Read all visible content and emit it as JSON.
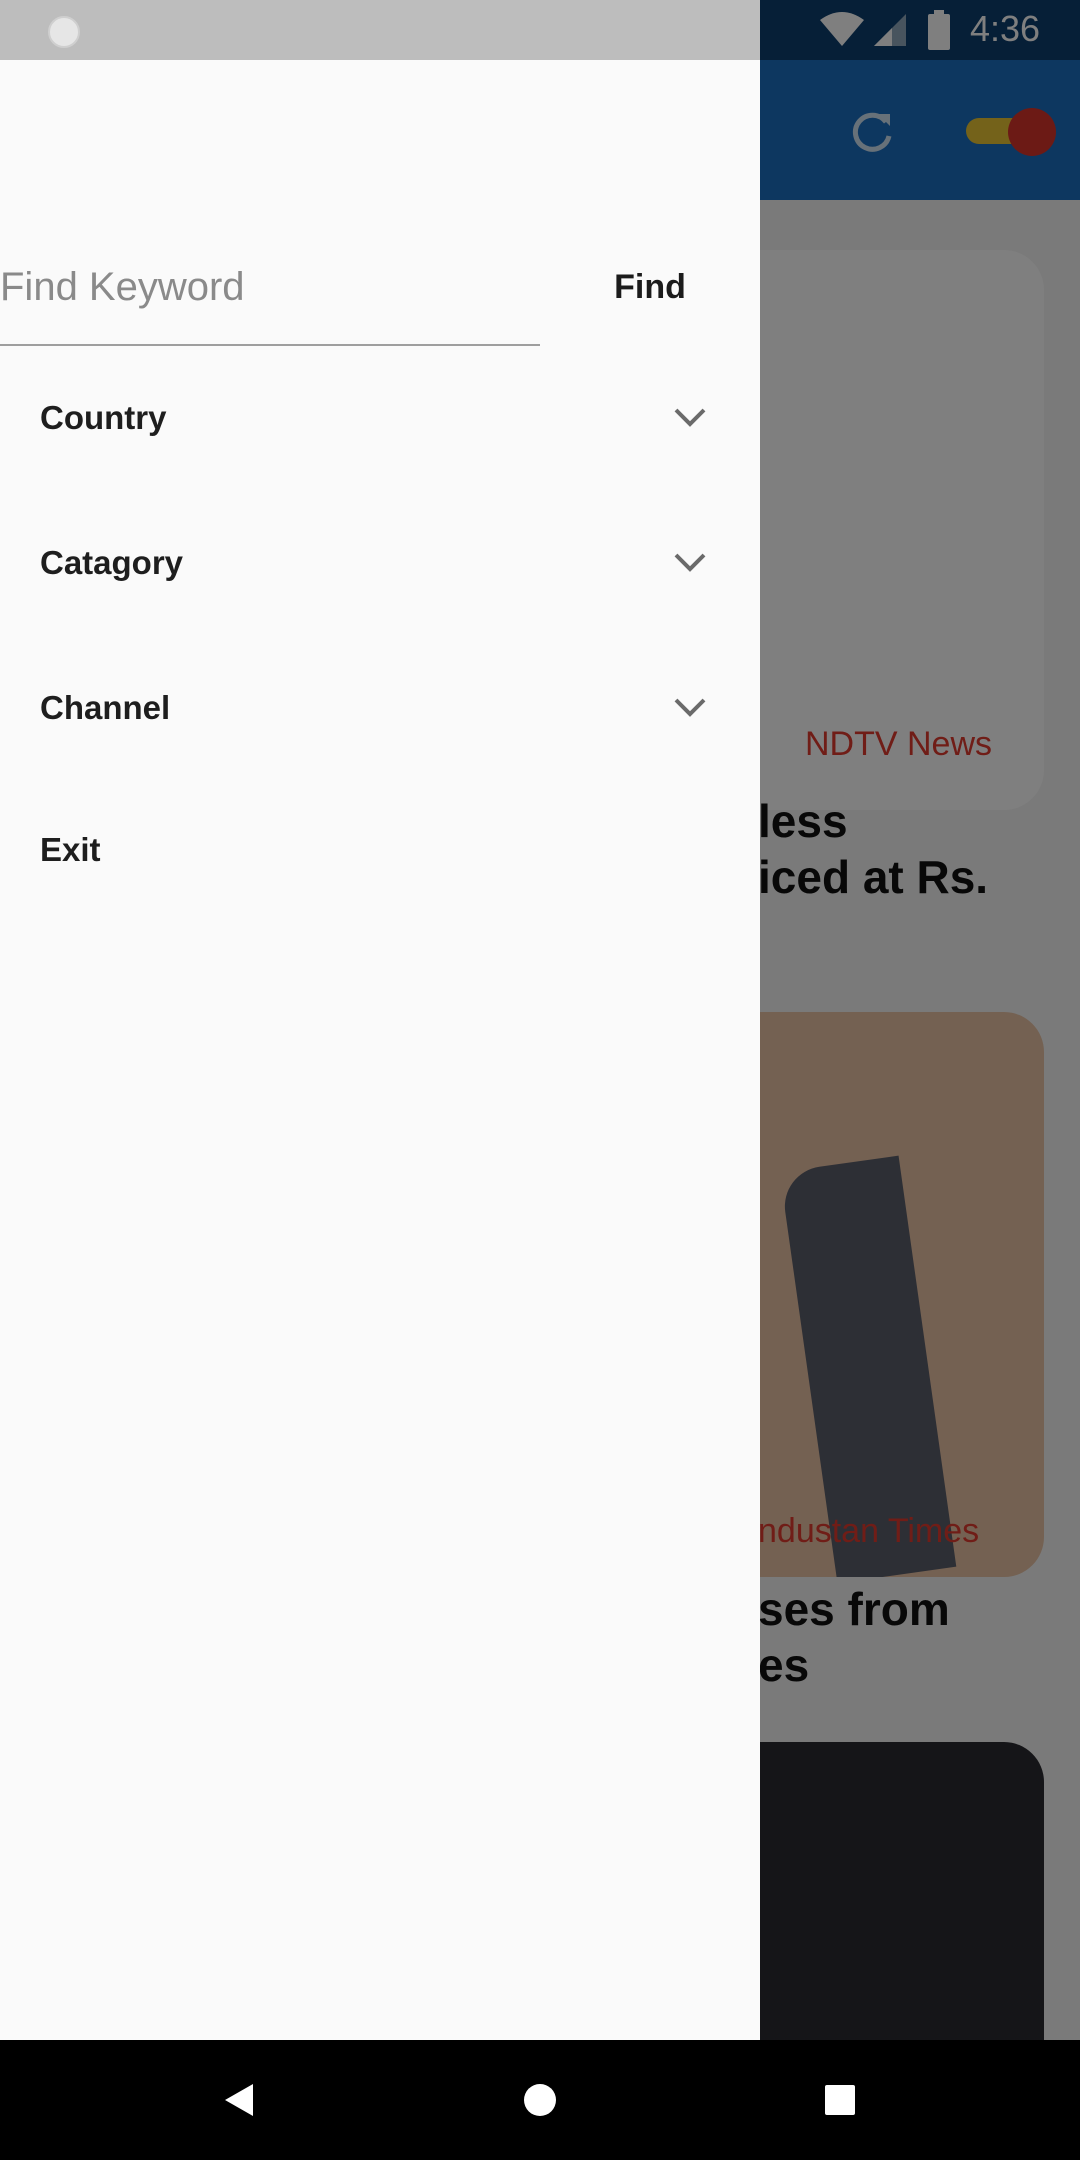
{
  "status_bar": {
    "time": "4:36"
  },
  "background_feed": {
    "cards": [
      {
        "source": "NDTV News",
        "title_fragment_line1": "less",
        "title_fragment_line2": "iced at Rs."
      },
      {
        "source": "ndustan Times",
        "title_fragment_line1": "ses from",
        "title_fragment_line2": "es"
      }
    ]
  },
  "drawer": {
    "search": {
      "placeholder": "Find Keyword",
      "value": "",
      "button_label": "Find"
    },
    "menu": [
      {
        "label": "Country",
        "icon": "chevron-down-icon"
      },
      {
        "label": "Catagory",
        "icon": "chevron-down-icon"
      },
      {
        "label": "Channel",
        "icon": "chevron-down-icon"
      },
      {
        "label": "Exit"
      }
    ]
  },
  "colors": {
    "app_bar": "#1a6fc0",
    "drawer_bg": "#fafafa",
    "source_text": "#e03b2f",
    "toggle_track": "#e8c535",
    "toggle_thumb": "#d9352b"
  }
}
